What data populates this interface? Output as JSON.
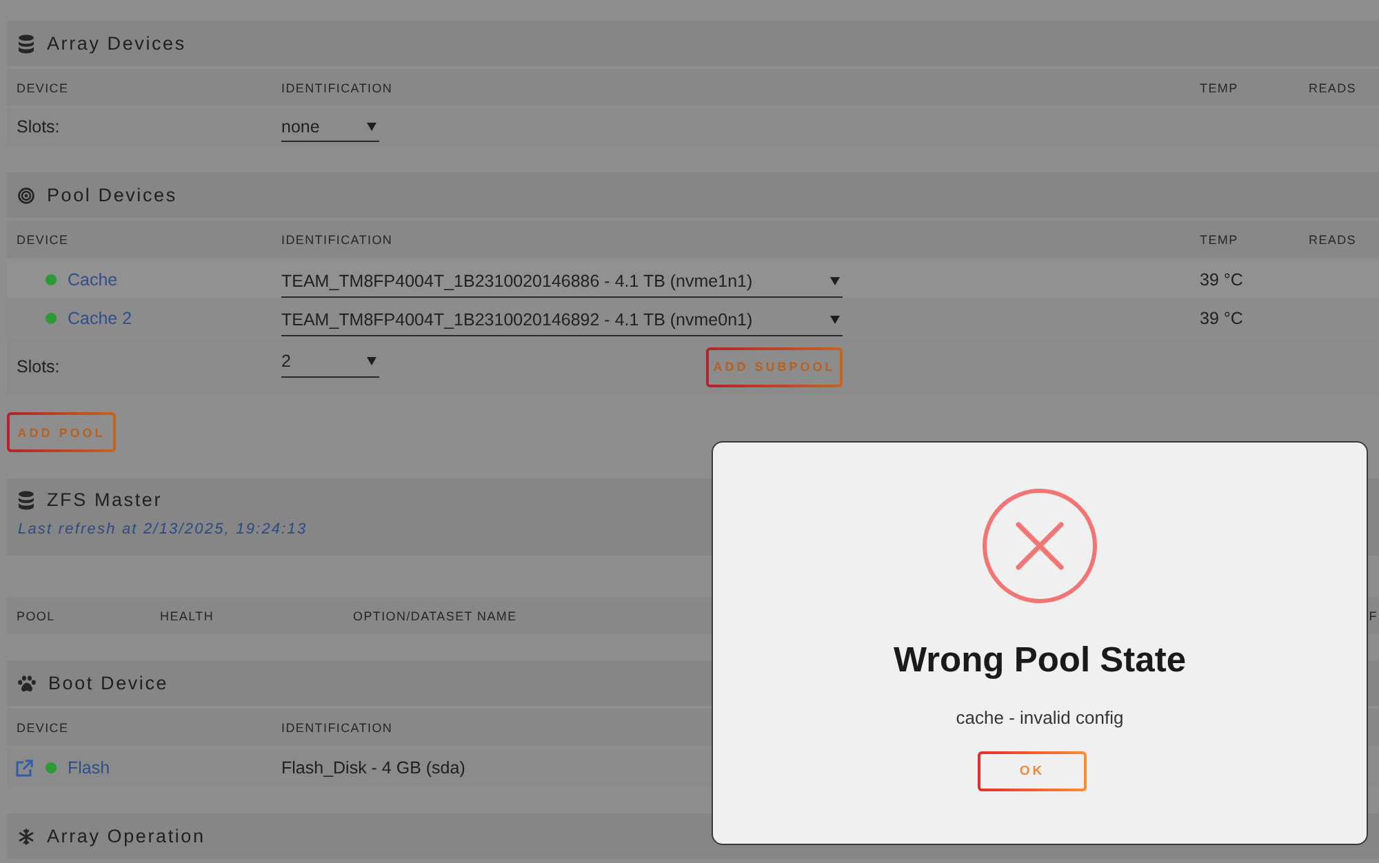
{
  "sections": [
    {
      "kind": "array",
      "title": "Array Devices",
      "columns": [
        "DEVICE",
        "IDENTIFICATION",
        "TEMP",
        "READS"
      ],
      "rows": [
        {
          "kind": "slots",
          "label": "Slots:",
          "value": "none"
        }
      ]
    },
    {
      "kind": "pool",
      "title": "Pool Devices",
      "columns": [
        "DEVICE",
        "IDENTIFICATION",
        "TEMP",
        "READS"
      ],
      "rows": [
        {
          "kind": "device",
          "external_link": false,
          "online": true,
          "name": "Cache",
          "identification": "TEAM_TM8FP4004T_1B2310020146886 - 4.1 TB (nvme1n1)",
          "temp": "39 °C"
        },
        {
          "kind": "device",
          "external_link": false,
          "online": true,
          "name": "Cache 2",
          "identification": "TEAM_TM8FP4004T_1B2310020146892 - 4.1 TB (nvme0n1)",
          "temp": "39 °C"
        },
        {
          "kind": "slots",
          "label": "Slots:",
          "value": "2",
          "button": "ADD SUBPOOL"
        }
      ],
      "footer_button": "ADD POOL"
    },
    {
      "kind": "zfs",
      "title": "ZFS Master",
      "subtitle": "Last refresh at 2/13/2025, 19:24:13",
      "columns": [
        "POOL",
        "HEALTH",
        "OPTION/DATASET NAME",
        "F"
      ]
    },
    {
      "kind": "boot",
      "title": "Boot Device",
      "columns": [
        "DEVICE",
        "IDENTIFICATION"
      ],
      "rows": [
        {
          "kind": "static",
          "external_link": true,
          "online": true,
          "name": "Flash",
          "identification": "Flash_Disk - 4 GB (sda)"
        }
      ]
    },
    {
      "kind": "operation",
      "title": "Array Operation"
    }
  ],
  "dialog": {
    "kind": "error",
    "title": "Wrong Pool State",
    "message": "cache - invalid config",
    "button": "OK"
  }
}
